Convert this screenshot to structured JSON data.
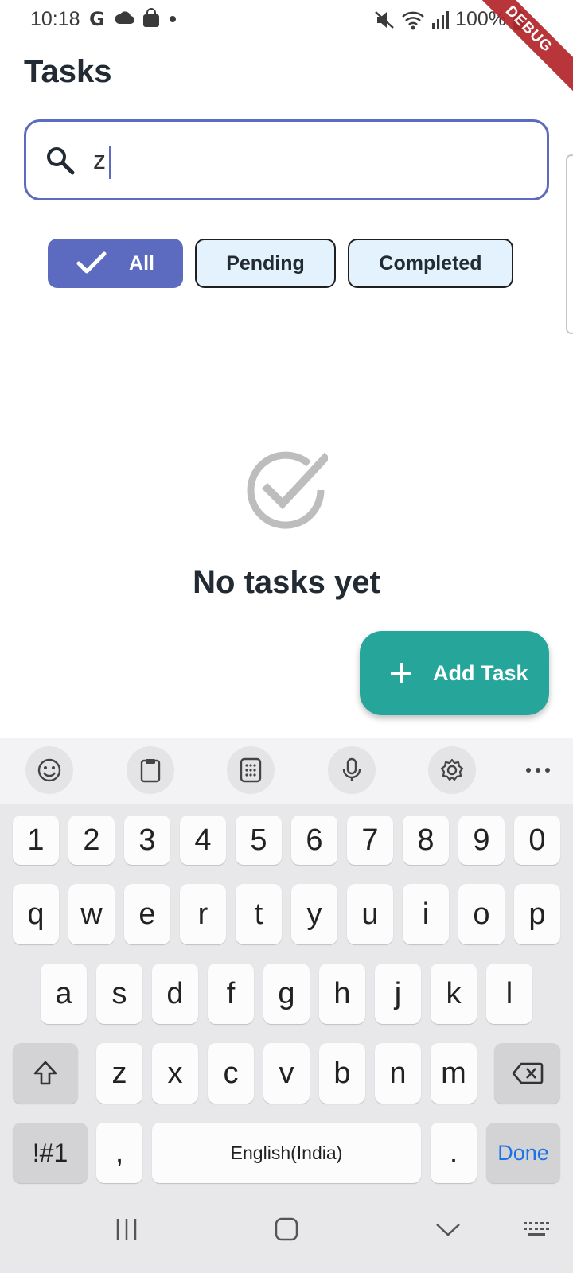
{
  "status_bar": {
    "time": "10:18",
    "battery": "100%",
    "left_icons": [
      "google-icon",
      "cloud-icon",
      "shopping-bag-icon",
      "dot-icon"
    ],
    "right_icons": [
      "mute-icon",
      "wifi-icon",
      "signal-icon",
      "battery-icon"
    ],
    "debug_banner": "DEBUG"
  },
  "app": {
    "title": "Tasks"
  },
  "search": {
    "value": "z",
    "icon": "search-icon"
  },
  "filters": [
    {
      "label": "All",
      "selected": true
    },
    {
      "label": "Pending",
      "selected": false
    },
    {
      "label": "Completed",
      "selected": false
    }
  ],
  "empty_state": {
    "icon": "check-circle-icon",
    "message": "No tasks yet"
  },
  "fab": {
    "label": "Add Task",
    "icon": "plus-icon"
  },
  "keyboard": {
    "toolbar": [
      "emoji-icon",
      "clipboard-icon",
      "keypad-icon",
      "microphone-icon",
      "settings-icon",
      "more-icon"
    ],
    "row_numbers": [
      "1",
      "2",
      "3",
      "4",
      "5",
      "6",
      "7",
      "8",
      "9",
      "0"
    ],
    "row1": [
      "q",
      "w",
      "e",
      "r",
      "t",
      "y",
      "u",
      "i",
      "o",
      "p"
    ],
    "row2": [
      "a",
      "s",
      "d",
      "f",
      "g",
      "h",
      "j",
      "k",
      "l"
    ],
    "row3": [
      "z",
      "x",
      "c",
      "v",
      "b",
      "n",
      "m"
    ],
    "symbols_label": "!#1",
    "comma": ",",
    "space_label": "English(India)",
    "period": ".",
    "done_label": "Done"
  },
  "colors": {
    "primary": "#5c6bc0",
    "chip_bg": "#e3f2fd",
    "fab": "#26a69a",
    "text": "#222b33",
    "debug": "#b3262a"
  }
}
